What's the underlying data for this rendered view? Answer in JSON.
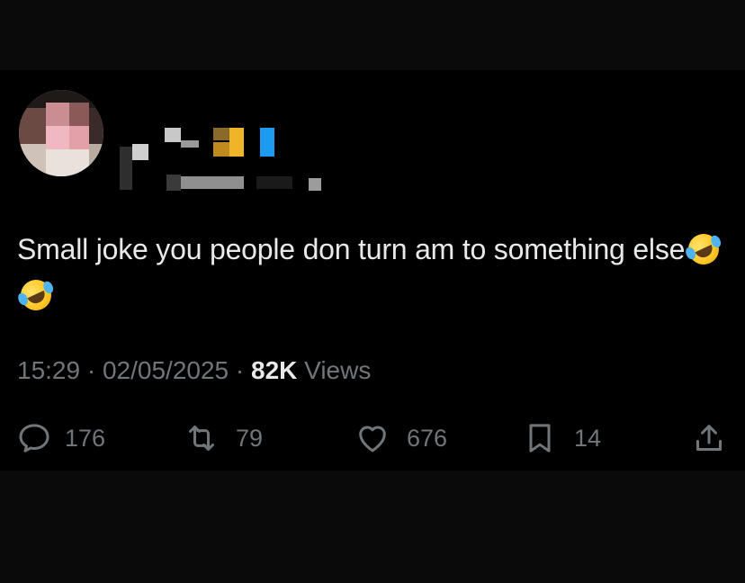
{
  "tweet": {
    "text": "Small joke you people don turn am to something else",
    "emojis": [
      "rolling-on-floor-laughing",
      "rolling-on-floor-laughing"
    ],
    "time": "15:29",
    "separator": "·",
    "date": "02/05/2025",
    "views_count": "82K",
    "views_label": "Views"
  },
  "actions": {
    "replies": "176",
    "reposts": "79",
    "likes": "676",
    "bookmarks": "14"
  },
  "colors": {
    "background": "#000000",
    "text": "#e7e9ea",
    "muted": "#71767b"
  }
}
